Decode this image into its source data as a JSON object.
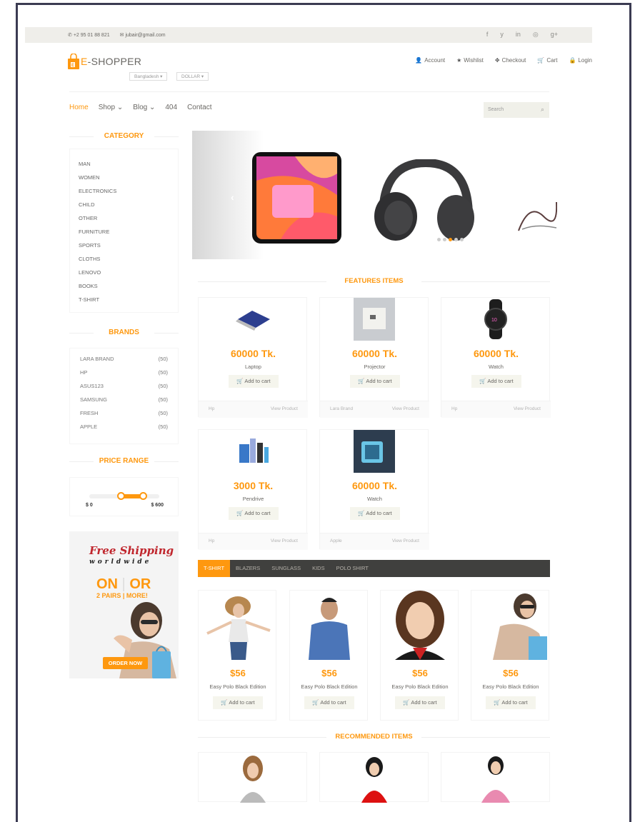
{
  "topbar": {
    "phone": "+2 95 01 88 821",
    "email": "jubair@gmail.com",
    "social": [
      "f",
      "y",
      "in",
      "◎",
      "g+"
    ]
  },
  "logo": {
    "e": "E",
    "rest": "-SHOPPER"
  },
  "selectors": {
    "country": "Bangladesh ▾",
    "currency": "DOLLAR ▾"
  },
  "account_menu": [
    {
      "icon": "user-icon",
      "glyph": "👤",
      "label": "Account"
    },
    {
      "icon": "star-icon",
      "glyph": "★",
      "label": "Wishlist"
    },
    {
      "icon": "crosshair-icon",
      "glyph": "✥",
      "label": "Checkout"
    },
    {
      "icon": "cart-icon",
      "glyph": "🛒",
      "label": "Cart"
    },
    {
      "icon": "lock-icon",
      "glyph": "🔒",
      "label": "Login"
    }
  ],
  "nav": [
    "Home",
    "Shop ⌄",
    "Blog ⌄",
    "404",
    "Contact"
  ],
  "search": {
    "placeholder": "Search"
  },
  "sidebar": {
    "category_title": "CATEGORY",
    "categories": [
      "MAN",
      "WOMEN",
      "ELECTRONICS",
      "CHILD",
      "OTHER",
      "FURNITURE",
      "SPORTS",
      "CLOTHS",
      "LENOVO",
      "BOOKS",
      "T-SHIRT"
    ],
    "brands_title": "BRANDS",
    "brands": [
      {
        "name": "LARA BRAND",
        "count": "(50)"
      },
      {
        "name": "HP",
        "count": "(50)"
      },
      {
        "name": "ASUS123",
        "count": "(50)"
      },
      {
        "name": "SAMSUNG",
        "count": "(50)"
      },
      {
        "name": "FRESH",
        "count": "(50)"
      },
      {
        "name": "APPLE",
        "count": "(50)"
      }
    ],
    "price_title": "PRICE RANGE",
    "price_min": "$ 0",
    "price_max": "$ 600",
    "price_range_fraction": [
      0.45,
      0.75
    ]
  },
  "ad": {
    "line1": "Free Shipping",
    "line2": "worldwide",
    "line3a": "ON",
    "line3b": "OR",
    "line4a": "2 PAIRS",
    "line4b": "MORE!",
    "cta": "ORDER NOW"
  },
  "slider": {
    "active_dot": 2,
    "dot_count": 5,
    "arrow": "‹"
  },
  "features_title": "FEATURES ITEMS",
  "features": [
    {
      "price": "60000 Tk.",
      "name": "Laptop",
      "add": "Add to cart",
      "brand": "Hp",
      "view": "View Product"
    },
    {
      "price": "60000 Tk.",
      "name": "Projector",
      "add": "Add to cart",
      "brand": "Lara Brand",
      "view": "View Product"
    },
    {
      "price": "60000 Tk.",
      "name": "Watch",
      "add": "Add to cart",
      "brand": "Hp",
      "view": "View Product"
    },
    {
      "price": "3000 Tk.",
      "name": "Pendrive",
      "add": "Add to cart",
      "brand": "Hp",
      "view": "View Product"
    },
    {
      "price": "60000 Tk.",
      "name": "Watch",
      "add": "Add to cart",
      "brand": "Apple",
      "view": "View Product"
    }
  ],
  "category_tabs": [
    "T-SHIRT",
    "BLAZERS",
    "SUNGLASS",
    "KIDS",
    "POLO SHIRT"
  ],
  "tab_products": [
    {
      "price": "$56",
      "name": "Easy Polo Black Edition",
      "add": "Add to cart"
    },
    {
      "price": "$56",
      "name": "Easy Polo Black Edition",
      "add": "Add to cart"
    },
    {
      "price": "$56",
      "name": "Easy Polo Black Edition",
      "add": "Add to cart"
    },
    {
      "price": "$56",
      "name": "Easy Polo Black Edition",
      "add": "Add to cart"
    }
  ],
  "recommended_title": "RECOMMENDED ITEMS",
  "colors": {
    "accent": "#fe980f",
    "text": "#696763",
    "tabbar": "#40403e",
    "topbar": "#efeeea"
  }
}
